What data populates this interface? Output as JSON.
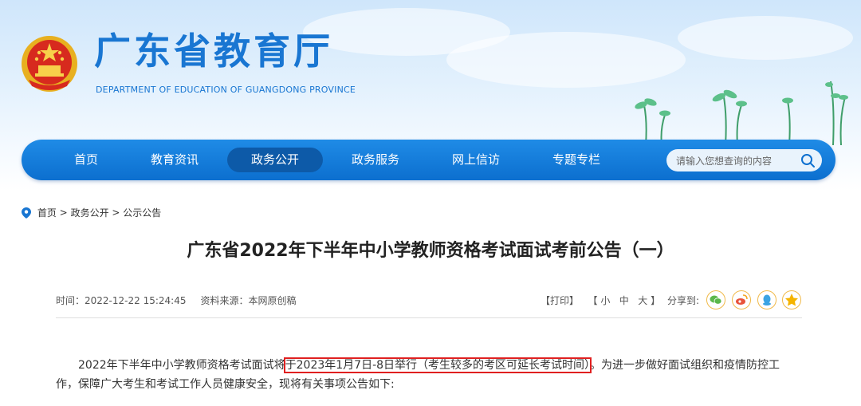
{
  "header": {
    "title": "广东省教育厅",
    "subtitle": "DEPARTMENT OF EDUCATION OF GUANGDONG PROVINCE"
  },
  "nav": {
    "items": [
      {
        "label": "首页"
      },
      {
        "label": "教育资讯"
      },
      {
        "label": "政务公开",
        "active": true
      },
      {
        "label": "政务服务"
      },
      {
        "label": "网上信访"
      },
      {
        "label": "专题专栏"
      }
    ],
    "search_placeholder": "请输入您想查询的内容"
  },
  "breadcrumb": {
    "items": [
      "首页",
      "政务公开",
      "公示公告"
    ],
    "separator": ">"
  },
  "article": {
    "title": "广东省2022年下半年中小学教师资格考试面试考前公告（一）",
    "time_label": "时间：",
    "time_value": "2022-12-22 15:24:45",
    "source_label": "资料来源：",
    "source_value": "本网原创稿",
    "print": "【打印】",
    "size_open": "【",
    "size_small": "小",
    "size_medium": "中",
    "size_large": "大",
    "size_close": "】",
    "share_label": "分享到:",
    "share_icons": [
      "wechat-icon",
      "weibo-icon",
      "qq-icon",
      "qzone-icon"
    ],
    "para_before": "2022年下半年中小学教师资格考试面试将",
    "para_highlight": "于2023年1月7日-8日举行（考生较多的考区可延长考试时间）",
    "para_after": "。为进一步做好面试组织和疫情防控工作，保障广大考生和考试工作人员健康安全，现将有关事项公告如下:"
  },
  "colors": {
    "brand_blue": "#1976d2",
    "nav_blue": "#1380dc",
    "nav_active": "#0d5aa8",
    "highlight_red": "#e02020"
  }
}
